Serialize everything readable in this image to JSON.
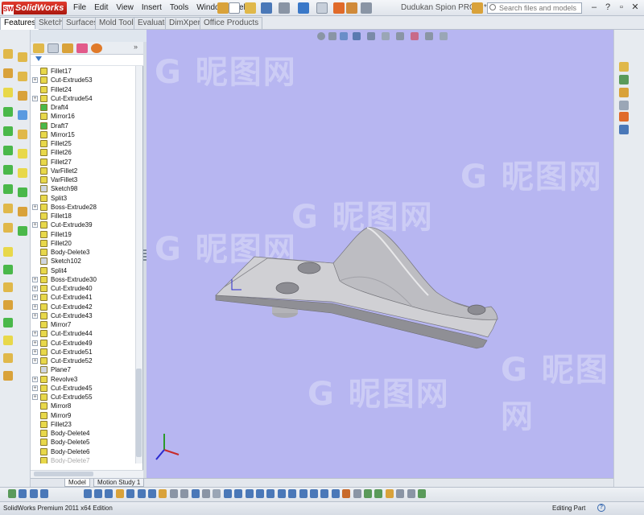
{
  "app": {
    "logo_text": "SolidWorks",
    "document_title": "Dudukan Spion PROD *",
    "menus": [
      "File",
      "Edit",
      "View",
      "Insert",
      "Tools",
      "Window",
      "Help"
    ],
    "search_placeholder": "Search files and models"
  },
  "command_tabs": [
    "Features",
    "Sketch",
    "Surfaces",
    "Mold Tools",
    "Evaluate",
    "DimXpert",
    "Office Products"
  ],
  "active_tab": "Features",
  "feature_tree": [
    {
      "label": "Fillet17",
      "expand": false,
      "icon": "fillet-icon",
      "color": "#e8d84a"
    },
    {
      "label": "Cut-Extrude53",
      "expand": true,
      "icon": "cut-extrude-icon",
      "color": "#e8d84a"
    },
    {
      "label": "Fillet24",
      "expand": false,
      "icon": "fillet-icon",
      "color": "#e8d84a"
    },
    {
      "label": "Cut-Extrude54",
      "expand": true,
      "icon": "cut-extrude-icon",
      "color": "#e8d84a"
    },
    {
      "label": "Draft4",
      "expand": false,
      "icon": "draft-icon",
      "color": "#4ab84a"
    },
    {
      "label": "Mirror16",
      "expand": false,
      "icon": "mirror-icon",
      "color": "#e8d84a"
    },
    {
      "label": "Draft7",
      "expand": false,
      "icon": "draft-icon",
      "color": "#4ab84a"
    },
    {
      "label": "Mirror15",
      "expand": false,
      "icon": "mirror-icon",
      "color": "#e8d84a"
    },
    {
      "label": "Fillet25",
      "expand": false,
      "icon": "fillet-icon",
      "color": "#e8d84a"
    },
    {
      "label": "Fillet26",
      "expand": false,
      "icon": "fillet-icon",
      "color": "#e8d84a"
    },
    {
      "label": "Fillet27",
      "expand": false,
      "icon": "fillet-icon",
      "color": "#e8d84a"
    },
    {
      "label": "VarFillet2",
      "expand": false,
      "icon": "variable-fillet-icon",
      "color": "#e8d84a"
    },
    {
      "label": "VarFillet3",
      "expand": false,
      "icon": "variable-fillet-icon",
      "color": "#e8d84a"
    },
    {
      "label": "Sketch98",
      "expand": false,
      "icon": "sketch-icon",
      "color": "#cfd6e0"
    },
    {
      "label": "Split3",
      "expand": false,
      "icon": "split-icon",
      "color": "#e8d84a"
    },
    {
      "label": "Boss-Extrude28",
      "expand": true,
      "icon": "boss-extrude-icon",
      "color": "#e8d84a"
    },
    {
      "label": "Fillet18",
      "expand": false,
      "icon": "fillet-icon",
      "color": "#e8d84a"
    },
    {
      "label": "Cut-Extrude39",
      "expand": true,
      "icon": "cut-extrude-icon",
      "color": "#e8d84a"
    },
    {
      "label": "Fillet19",
      "expand": false,
      "icon": "fillet-icon",
      "color": "#e8d84a"
    },
    {
      "label": "Fillet20",
      "expand": false,
      "icon": "fillet-icon",
      "color": "#e8d84a"
    },
    {
      "label": "Body-Delete3",
      "expand": false,
      "icon": "body-delete-icon",
      "color": "#e8d84a"
    },
    {
      "label": "Sketch102",
      "expand": false,
      "icon": "sketch-icon",
      "color": "#cfd6e0"
    },
    {
      "label": "Split4",
      "expand": false,
      "icon": "split-icon",
      "color": "#e8d84a"
    },
    {
      "label": "Boss-Extrude30",
      "expand": true,
      "icon": "boss-extrude-icon",
      "color": "#e8d84a"
    },
    {
      "label": "Cut-Extrude40",
      "expand": true,
      "icon": "cut-extrude-icon",
      "color": "#e8d84a"
    },
    {
      "label": "Cut-Extrude41",
      "expand": true,
      "icon": "cut-extrude-icon",
      "color": "#e8d84a"
    },
    {
      "label": "Cut-Extrude42",
      "expand": true,
      "icon": "cut-extrude-icon",
      "color": "#e8d84a"
    },
    {
      "label": "Cut-Extrude43",
      "expand": true,
      "icon": "cut-extrude-icon",
      "color": "#e8d84a"
    },
    {
      "label": "Mirror7",
      "expand": false,
      "icon": "mirror-icon",
      "color": "#e8d84a"
    },
    {
      "label": "Cut-Extrude44",
      "expand": true,
      "icon": "cut-extrude-icon",
      "color": "#e8d84a"
    },
    {
      "label": "Cut-Extrude49",
      "expand": true,
      "icon": "cut-extrude-icon",
      "color": "#e8d84a"
    },
    {
      "label": "Cut-Extrude51",
      "expand": true,
      "icon": "cut-extrude-icon",
      "color": "#e8d84a"
    },
    {
      "label": "Cut-Extrude52",
      "expand": true,
      "icon": "cut-extrude-icon",
      "color": "#e8d84a"
    },
    {
      "label": "Plane7",
      "expand": false,
      "icon": "plane-icon",
      "color": "#cfd6e0"
    },
    {
      "label": "Revolve3",
      "expand": true,
      "icon": "revolve-icon",
      "color": "#e8d84a"
    },
    {
      "label": "Cut-Extrude45",
      "expand": true,
      "icon": "cut-extrude-icon",
      "color": "#e8d84a"
    },
    {
      "label": "Cut-Extrude55",
      "expand": true,
      "icon": "cut-extrude-icon",
      "color": "#e8d84a"
    },
    {
      "label": "Mirror8",
      "expand": false,
      "icon": "mirror-icon",
      "color": "#e8d84a"
    },
    {
      "label": "Mirror9",
      "expand": false,
      "icon": "mirror-icon",
      "color": "#e8d84a"
    },
    {
      "label": "Fillet23",
      "expand": false,
      "icon": "fillet-icon",
      "color": "#e8d84a"
    },
    {
      "label": "Body-Delete4",
      "expand": false,
      "icon": "body-delete-icon",
      "color": "#e8d84a"
    },
    {
      "label": "Body-Delete5",
      "expand": false,
      "icon": "body-delete-icon",
      "color": "#e8d84a"
    },
    {
      "label": "Body-Delete6",
      "expand": false,
      "icon": "body-delete-icon",
      "color": "#e8d84a"
    },
    {
      "label": "Body-Delete7",
      "expand": false,
      "icon": "body-delete-icon",
      "color": "#e8d84a",
      "dim": true
    }
  ],
  "bottom_tabs": [
    "Model",
    "Motion Study 1"
  ],
  "active_bottom_tab": "Model",
  "status": {
    "left": "SolidWorks Premium 2011 x64 Edition",
    "right": "Editing Part"
  },
  "watermark_text": "昵图网",
  "colors": {
    "viewport_bg": "#b7b6f1",
    "part_fill": "#c9c9cd",
    "brand_red": "#c8241a"
  }
}
